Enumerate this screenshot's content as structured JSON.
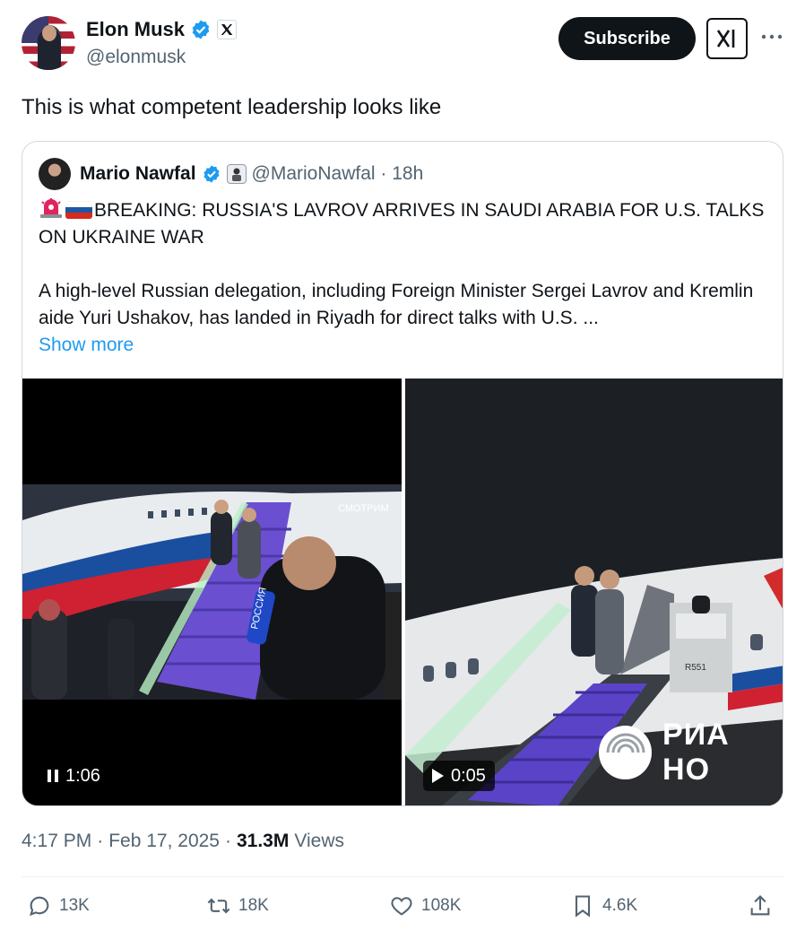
{
  "author": {
    "name": "Elon Musk",
    "handle": "@elonmusk"
  },
  "buttons": {
    "subscribe": "Subscribe"
  },
  "tweet": {
    "text": "This is what competent leadership looks like"
  },
  "quote": {
    "name": "Mario Nawfal",
    "handle_time": "@MarioNawfal · 18h",
    "headline": "BREAKING: RUSSIA'S LAVROV ARRIVES IN SAUDI ARABIA FOR U.S. TALKS ON UKRAINE WAR",
    "body": "A high-level Russian delegation, including Foreign Minister Sergei Lavrov and Kremlin aide Yuri Ushakov, has landed in Riyadh for direct talks with U.S. ...",
    "show_more": "Show more",
    "videos": [
      {
        "duration": "1:06",
        "state": "paused",
        "overlay_text": "СМОТРИМ",
        "mic_text": "РОССИЯ"
      },
      {
        "duration": "0:05",
        "state": "play",
        "watermark": "РИА НО",
        "vehicle_text": "R551"
      }
    ]
  },
  "meta": {
    "time": "4:17 PM",
    "date": "Feb 17, 2025",
    "views_count": "31.3M",
    "views_label": "Views",
    "sep": "·"
  },
  "actions": {
    "replies": "13K",
    "reposts": "18K",
    "likes": "108K",
    "bookmarks": "4.6K"
  },
  "colors": {
    "accent": "#1d9bf0",
    "text": "#0f1419",
    "muted": "#536471",
    "border": "#cfd9de"
  }
}
